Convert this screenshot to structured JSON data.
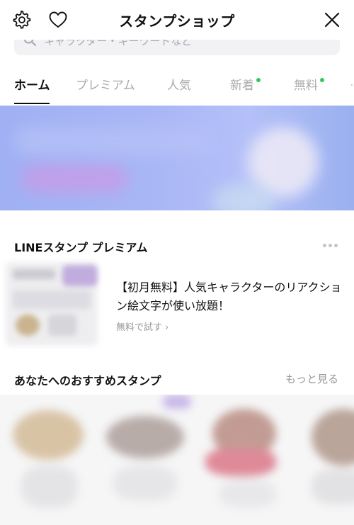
{
  "header": {
    "title": "スタンプショップ",
    "icons": [
      "gear-icon",
      "heart-icon",
      "close-icon"
    ]
  },
  "search": {
    "placeholder": "キャラクター・キーワードなど"
  },
  "tabs": [
    {
      "label": "ホーム",
      "active": true
    },
    {
      "label": "プレミアム",
      "active": false
    },
    {
      "label": "人気",
      "active": false
    },
    {
      "label": "新着",
      "active": false,
      "dot": true
    },
    {
      "label": "無料",
      "active": false,
      "dot": true
    }
  ],
  "premium": {
    "title": "LINEスタンプ プレミアム",
    "promo_text": "【初月無料】人気キャラクターのリアクション絵文字が使い放題！",
    "promo_link": "無料で試す ›"
  },
  "recommend": {
    "title": "あなたへのおすすめスタンプ",
    "see_more": "もっと見る"
  },
  "colors": {
    "accent_dot": "#35c759",
    "text_primary": "#111111",
    "text_secondary": "#999999",
    "tab_inactive": "#aaaaaa",
    "banner": "#a9b7f6"
  }
}
